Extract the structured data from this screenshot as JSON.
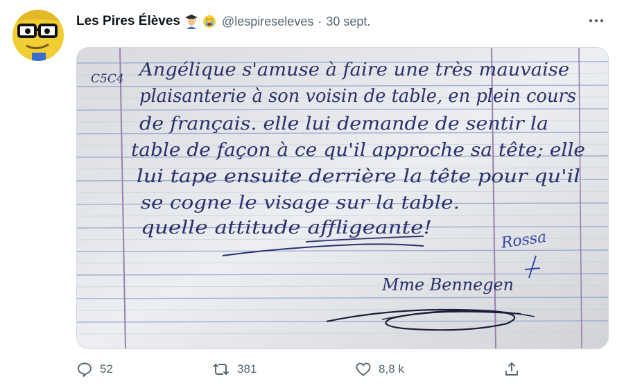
{
  "tweet": {
    "author_name": "Les Pires Élèves",
    "author_emojis": [
      "graduation-cap-person-emoji",
      "crying-face-emoji"
    ],
    "handle": "@lespireseleves",
    "separator": "·",
    "date": "30 sept.",
    "more_label": "···"
  },
  "media": {
    "note": {
      "class_code": "C5C4",
      "lines": [
        "Angélique s'amuse à faire une très mauvaise",
        "plaisanterie à son voisin de table, en plein cours",
        "de français. elle lui demande de sentir la",
        "table de façon à ce qu'il approche sa tête; elle",
        "lui tape ensuite derrière la tête pour qu'il",
        "se cogne le visage sur la table.",
        "quelle attitude affligeante!"
      ],
      "signature": "Mme Bennegen",
      "initials": "Rossa"
    }
  },
  "actions": {
    "replies": "52",
    "retweets": "381",
    "likes": "8,8 k"
  },
  "colors": {
    "text": "#0f1419",
    "muted": "#536471",
    "ink": "#29306b",
    "paper": "#e7e8ec",
    "rule_blue": "#8ea2c6",
    "margin_line": "#9a7fb0"
  }
}
